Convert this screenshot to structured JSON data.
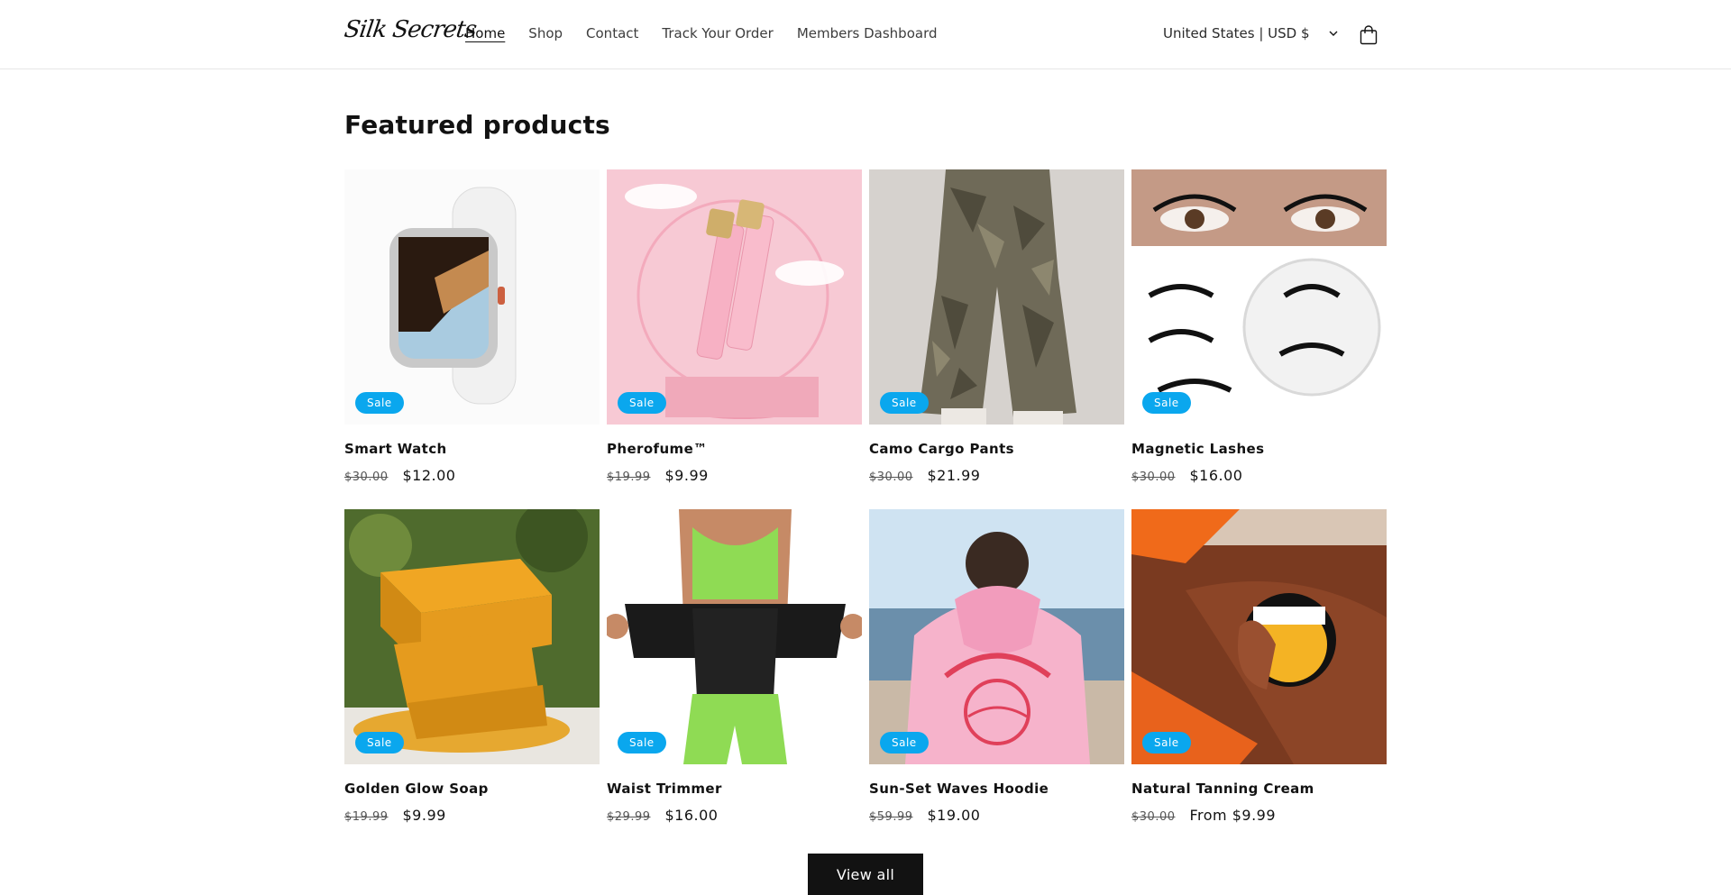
{
  "header": {
    "logo": "Silk Secrets",
    "nav": [
      {
        "label": "Home",
        "active": true
      },
      {
        "label": "Shop"
      },
      {
        "label": "Contact"
      },
      {
        "label": "Track Your Order"
      },
      {
        "label": "Members Dashboard"
      }
    ],
    "country": "United States | USD $",
    "icons": {
      "country_chevron": "chevron-down-icon",
      "cart": "cart-icon"
    }
  },
  "section": {
    "title": "Featured products"
  },
  "products": [
    {
      "name": "Smart Watch",
      "old_price": "$30.00",
      "price": "$12.00",
      "badge": "Sale",
      "image": "smart-watch-image"
    },
    {
      "name": "Pherofume™",
      "old_price": "$19.99",
      "price": "$9.99",
      "badge": "Sale",
      "image": "perfume-bottles-image"
    },
    {
      "name": "Camo Cargo Pants",
      "old_price": "$30.00",
      "price": "$21.99",
      "badge": "Sale",
      "image": "camo-pants-image"
    },
    {
      "name": "Magnetic Lashes",
      "old_price": "$30.00",
      "price": "$16.00",
      "badge": "Sale",
      "image": "lashes-image"
    },
    {
      "name": "Golden Glow Soap",
      "old_price": "$19.99",
      "price": "$9.99",
      "badge": "Sale",
      "image": "soap-bars-image"
    },
    {
      "name": "Waist Trimmer",
      "old_price": "$29.99",
      "price": "$16.00",
      "badge": "Sale",
      "image": "waist-trimmer-image"
    },
    {
      "name": "Sun-Set Waves Hoodie",
      "old_price": "$59.99",
      "price": "$19.00",
      "badge": "Sale",
      "image": "hoodie-image"
    },
    {
      "name": "Natural Tanning Cream",
      "old_price": "$30.00",
      "price": "From $9.99",
      "badge": "Sale",
      "image": "tanning-cream-image"
    }
  ],
  "view_all": "View all",
  "colors": {
    "badge": "#0aa7ee",
    "button": "#121212"
  }
}
